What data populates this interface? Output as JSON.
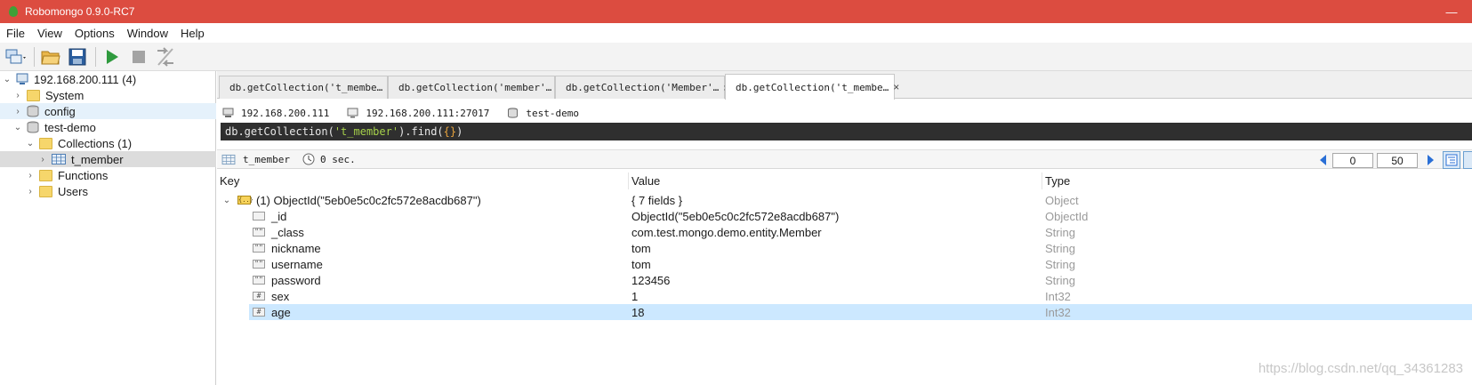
{
  "window": {
    "title": "Robomongo 0.9.0-RC7",
    "minimize_glyph": "—"
  },
  "menu": [
    "File",
    "View",
    "Options",
    "Window",
    "Help"
  ],
  "toolbar": {
    "icons": [
      "connect-icon",
      "open-icon",
      "save-icon",
      "execute-icon",
      "stop-icon",
      "orientation-icon"
    ]
  },
  "sidebar": {
    "server": "192.168.200.111 (4)",
    "items": [
      {
        "label": "System",
        "kind": "folder"
      },
      {
        "label": "config",
        "kind": "database"
      },
      {
        "label": "test-demo",
        "kind": "database"
      },
      {
        "label": "Collections (1)",
        "kind": "folder"
      },
      {
        "label": "t_member",
        "kind": "collection"
      },
      {
        "label": "Functions",
        "kind": "folder"
      },
      {
        "label": "Users",
        "kind": "folder"
      }
    ]
  },
  "tabs": [
    {
      "label": "db.getCollection('t_membe…",
      "close": "×"
    },
    {
      "label": "db.getCollection('member'…",
      "close": "×"
    },
    {
      "label": "db.getCollection('Member'…",
      "close": "×"
    },
    {
      "label": "db.getCollection('t_membe…",
      "close": "×"
    }
  ],
  "connection": {
    "server": "192.168.200.111",
    "host": "192.168.200.111:27017",
    "database": "test-demo"
  },
  "query": {
    "prefix": "db.getCollection(",
    "collection": "'t_member'",
    "middle": ").find(",
    "arg": "{}",
    "suffix": ")"
  },
  "result": {
    "collection": "t_member",
    "time": "0 sec.",
    "page_start": "0",
    "page_size": "50"
  },
  "grid": {
    "columns": [
      "Key",
      "Value",
      "Type"
    ],
    "document": {
      "key": "(1) ObjectId(\"5eb0e5c0c2fc572e8acdb687\")",
      "value": "{ 7 fields }",
      "type": "Object",
      "icon_text": "{..}"
    },
    "fields": [
      {
        "key": "_id",
        "value": "ObjectId(\"5eb0e5c0c2fc572e8acdb687\")",
        "type": "ObjectId",
        "icon": ""
      },
      {
        "key": "_class",
        "value": "com.test.mongo.demo.entity.Member",
        "type": "String",
        "icon": "\"\""
      },
      {
        "key": "nickname",
        "value": "tom",
        "type": "String",
        "icon": "\"\""
      },
      {
        "key": "username",
        "value": "tom",
        "type": "String",
        "icon": "\"\""
      },
      {
        "key": "password",
        "value": "123456",
        "type": "String",
        "icon": "\"\""
      },
      {
        "key": "sex",
        "value": "1",
        "type": "Int32",
        "icon": "#"
      },
      {
        "key": "age",
        "value": "18",
        "type": "Int32",
        "icon": "#"
      }
    ]
  },
  "watermark": "https://blog.csdn.net/qq_34361283",
  "colors": {
    "titlebar": "#dc4c40",
    "selection": "#cce8ff",
    "query_background": "#2f2f2f",
    "mongo_leaf": "#3fa037"
  }
}
